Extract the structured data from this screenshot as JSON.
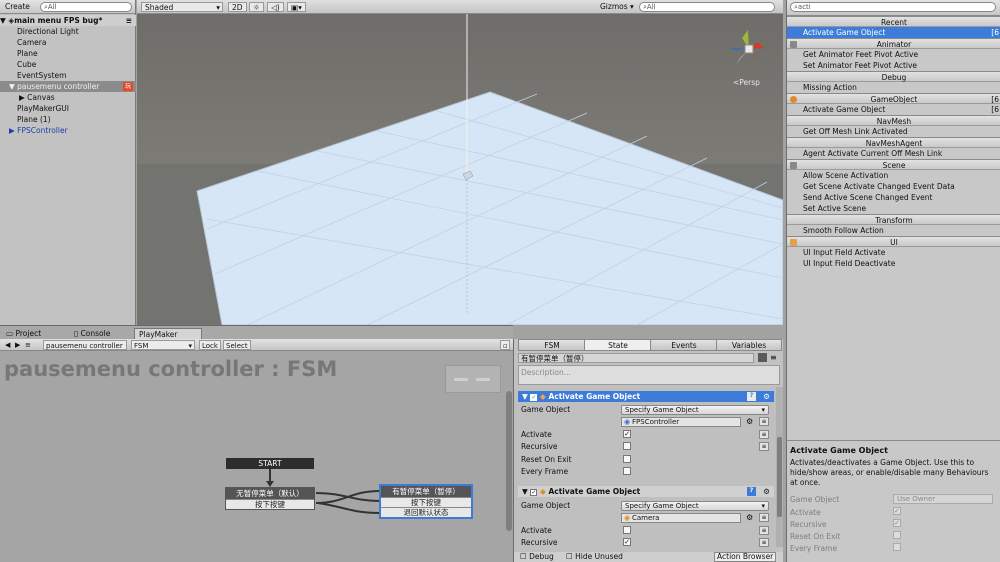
{
  "hierarchy": {
    "create_label": "Create",
    "search_placeholder": "All",
    "scene_name": "main menu FPS bug*",
    "items": [
      "Directional Light",
      "Camera",
      "Plane",
      "Cube",
      "EventSystem",
      "pausemenu controller",
      "Canvas",
      "PlayMakerGUI",
      "Plane (1)",
      "FPSController"
    ],
    "badge": "玩"
  },
  "scene": {
    "shading": "Shaded",
    "mode_2d": "2D",
    "gizmos": "Gizmos",
    "search_placeholder": "All",
    "persp_label": "Persp"
  },
  "actions_panel": {
    "search_value": "acti",
    "categories": [
      {
        "name": "Recent",
        "actions": [
          {
            "label": "Activate Game Object",
            "count": "[6",
            "selected": true
          }
        ]
      },
      {
        "name": "Animator",
        "actions": [
          {
            "label": "Get Animator Feet Pivot Active"
          },
          {
            "label": "Set Animator Feet Pivot Active"
          }
        ]
      },
      {
        "name": "Debug",
        "actions": [
          {
            "label": "Missing Action"
          }
        ]
      },
      {
        "name": "GameObject",
        "count": "[6",
        "actions": [
          {
            "label": "Activate Game Object",
            "count": "[6"
          }
        ]
      },
      {
        "name": "NavMesh",
        "actions": [
          {
            "label": "Get Off Mesh Link Activated"
          }
        ]
      },
      {
        "name": "NavMeshAgent",
        "actions": [
          {
            "label": "Agent Activate Current Off Mesh Link"
          }
        ]
      },
      {
        "name": "Scene",
        "actions": [
          {
            "label": "Allow Scene Activation"
          },
          {
            "label": "Get Scene Activate Changed Event Data"
          },
          {
            "label": "Send Active Scene Changed Event"
          },
          {
            "label": "Set Active Scene"
          }
        ]
      },
      {
        "name": "Transform",
        "actions": [
          {
            "label": "Smooth Follow Action"
          }
        ]
      },
      {
        "name": "UI",
        "actions": [
          {
            "label": "UI Input Field Activate"
          },
          {
            "label": "UI Input Field Deactivate"
          }
        ]
      }
    ]
  },
  "description": {
    "title": "Activate Game Object",
    "text": "Activates/deactivates a Game Object. Use this to hide/show areas, or enable/disable many Behaviours at once.",
    "fields": [
      {
        "label": "Game Object",
        "value": "Use Owner"
      },
      {
        "label": "Activate",
        "value": "✓"
      },
      {
        "label": "Recursive",
        "value": "✓"
      },
      {
        "label": "Reset On Exit",
        "value": ""
      },
      {
        "label": "Every Frame",
        "value": ""
      }
    ]
  },
  "bottom_tabs": {
    "project": "Project",
    "console": "Console",
    "playmaker": "PlayMaker"
  },
  "playmaker_bar": {
    "object": "pausemenu controller",
    "fsm": "FSM",
    "lock": "Lock",
    "select": "Select"
  },
  "graph": {
    "title": "pausemenu controller : FSM",
    "start_label": "START",
    "state_a": {
      "title": "无暂停菜单（默认）",
      "event": "按下按键"
    },
    "state_b": {
      "title": "有暂停菜单（暂停）",
      "events": [
        "按下按键",
        "退回默认状态"
      ]
    }
  },
  "inspector": {
    "tabs": [
      "FSM",
      "State",
      "Events",
      "Variables"
    ],
    "state_name": "有暂停菜单（暂停）",
    "description_placeholder": "Description...",
    "action1": {
      "title": "Activate Game Object",
      "game_object_label": "Game Object",
      "game_object_mode": "Specify Game Object",
      "object": "FPSController",
      "activate_label": "Activate",
      "activate": "✓",
      "recursive_label": "Recursive",
      "recursive": "",
      "reset_label": "Reset On Exit",
      "reset": "",
      "every_label": "Every Frame",
      "every": ""
    },
    "action2": {
      "title": "Activate Game Object",
      "game_object_label": "Game Object",
      "game_object_mode": "Specify Game Object",
      "object": "Camera",
      "activate_label": "Activate",
      "activate": "",
      "recursive_label": "Recursive",
      "recursive": "✓"
    },
    "footer": {
      "debug": "Debug",
      "hide_unused": "Hide Unused",
      "action_browser": "Action Browser"
    }
  },
  "colors": {
    "accent": "#3c7bd8",
    "plane": "#d7e6f6",
    "graph_bg": "#a5a5a5"
  }
}
